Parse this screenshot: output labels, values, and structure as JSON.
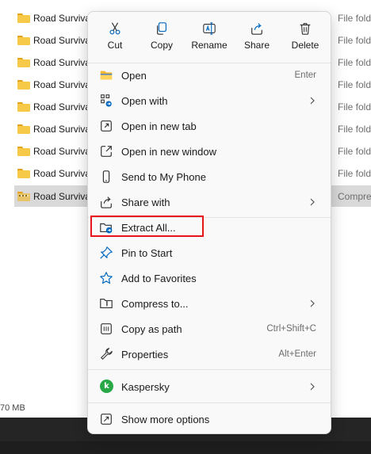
{
  "files": [
    {
      "name": "Road Surviva",
      "type": "File fold"
    },
    {
      "name": "Road Surviva",
      "type": "File fold"
    },
    {
      "name": "Road Surviva",
      "type": "File fold"
    },
    {
      "name": "Road Surviva",
      "type": "File fold"
    },
    {
      "name": "Road Surviva",
      "type": "File fold"
    },
    {
      "name": "Road Surviva",
      "type": "File fold"
    },
    {
      "name": "Road Surviva",
      "type": "File fold"
    },
    {
      "name": "Road Surviva",
      "type": "File fold"
    },
    {
      "name": "Road Surviva",
      "type": "Compres"
    }
  ],
  "status": {
    "size": "70 MB"
  },
  "menu": {
    "toolbar": {
      "cut": "Cut",
      "copy": "Copy",
      "rename": "Rename",
      "share": "Share",
      "delete": "Delete"
    },
    "items": {
      "open": {
        "label": "Open",
        "shortcut": "Enter"
      },
      "open_with": {
        "label": "Open with"
      },
      "open_new_tab": {
        "label": "Open in new tab"
      },
      "open_new_window": {
        "label": "Open in new window"
      },
      "send_to_phone": {
        "label": "Send to My Phone"
      },
      "share_with": {
        "label": "Share with"
      },
      "extract_all": {
        "label": "Extract All..."
      },
      "pin_to_start": {
        "label": "Pin to Start"
      },
      "add_favorites": {
        "label": "Add to Favorites"
      },
      "compress_to": {
        "label": "Compress to..."
      },
      "copy_as_path": {
        "label": "Copy as path",
        "shortcut": "Ctrl+Shift+C"
      },
      "properties": {
        "label": "Properties",
        "shortcut": "Alt+Enter"
      },
      "kaspersky": {
        "label": "Kaspersky",
        "badge": "k"
      },
      "show_more": {
        "label": "Show more options"
      }
    }
  },
  "colors": {
    "accent": "#0067c0",
    "highlight_border": "#e8141c",
    "folder": "#f7c948",
    "kaspersky": "#29a847"
  }
}
